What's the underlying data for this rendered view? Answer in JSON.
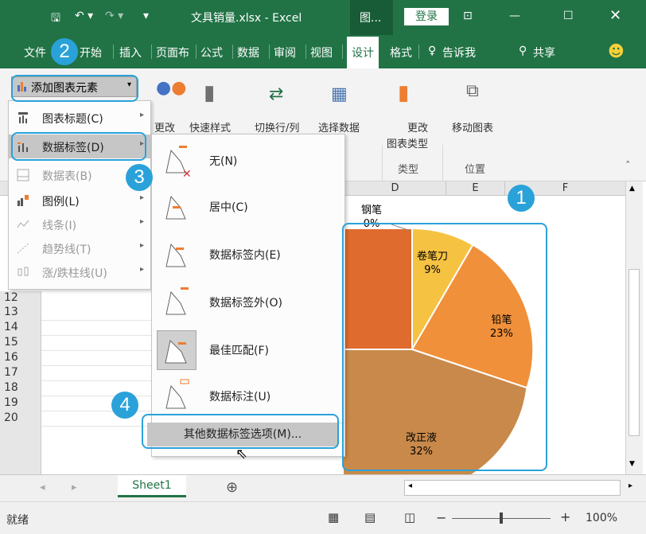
{
  "titlebar": {
    "filename": "文具销量.xlsx - Excel",
    "context_tab": "图...",
    "login": "登录"
  },
  "tabs": [
    {
      "label": "文件"
    },
    {
      "label": "开始"
    },
    {
      "label": "插入"
    },
    {
      "label": "页面布"
    },
    {
      "label": "公式"
    },
    {
      "label": "数据"
    },
    {
      "label": "审阅"
    },
    {
      "label": "视图"
    },
    {
      "label": "设计"
    },
    {
      "label": "格式"
    },
    {
      "label": "告诉我"
    },
    {
      "label": "共享"
    }
  ],
  "ribbon": {
    "add_element": "添加图表元素",
    "change_colors": "更改",
    "quick_styles": "快速样式",
    "switch_row_col": "切换行/列",
    "select_data": "选择数据",
    "change_type_1": "更改",
    "change_type_2": "图表类型",
    "move_chart": "移动图表",
    "group_type": "类型",
    "group_location": "位置"
  },
  "menu1": {
    "items": [
      {
        "label": "图表标题(C)",
        "disabled": false
      },
      {
        "label": "数据标签(D)",
        "disabled": false
      },
      {
        "label": "数据表(B)",
        "disabled": true
      },
      {
        "label": "图例(L)",
        "disabled": false
      },
      {
        "label": "线条(I)",
        "disabled": true
      },
      {
        "label": "趋势线(T)",
        "disabled": true
      },
      {
        "label": "涨/跌柱线(U)",
        "disabled": true
      }
    ]
  },
  "menu2": {
    "items": [
      {
        "label": "无(N)"
      },
      {
        "label": "居中(C)"
      },
      {
        "label": "数据标签内(E)"
      },
      {
        "label": "数据标签外(O)"
      },
      {
        "label": "最佳匹配(F)"
      },
      {
        "label": "数据标注(U)"
      }
    ],
    "more": "其他数据标签选项(M)..."
  },
  "columns": [
    "D",
    "E",
    "F"
  ],
  "rows": [
    "12",
    "13",
    "14",
    "15",
    "16",
    "17",
    "18",
    "19",
    "20"
  ],
  "badges": [
    "1",
    "2",
    "3",
    "4"
  ],
  "chart_data": {
    "type": "pie",
    "categories": [
      "钢笔",
      "卷笔刀",
      "铅笔",
      "改正液"
    ],
    "labels": [
      "0%",
      "9%",
      "23%",
      "32%"
    ],
    "colors": [
      "#f5c242",
      "#f0903a",
      "#c8894a",
      "#e06b2e"
    ]
  },
  "sheet_tab": "Sheet1",
  "status": {
    "ready": "就绪",
    "zoom": "100%"
  }
}
